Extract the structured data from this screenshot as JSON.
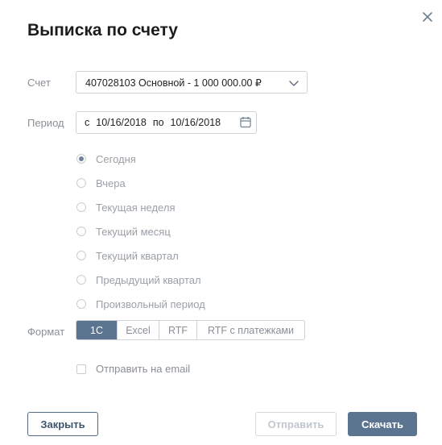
{
  "dialog": {
    "title": "Выписка по счету",
    "close_icon": "close-icon"
  },
  "account": {
    "label": "Счет",
    "selected": "407028103 Основной - 1 000 000.00 ₽",
    "icon": "chevron-down-icon"
  },
  "period": {
    "label": "Период",
    "from_prefix": "с",
    "from": "10/16/2018",
    "to_prefix": "по",
    "to": "10/16/2018",
    "icon": "calendar-icon",
    "options": [
      {
        "label": "Сегодня",
        "selected": true
      },
      {
        "label": "Вчера",
        "selected": false
      },
      {
        "label": "Текущая неделя",
        "selected": false
      },
      {
        "label": "Текущий месяц",
        "selected": false
      },
      {
        "label": "Текущий квартал",
        "selected": false
      },
      {
        "label": "Предыдущий квартал",
        "selected": false
      },
      {
        "label": "Произвольный период",
        "selected": false
      }
    ]
  },
  "format": {
    "label": "Формат",
    "options": [
      {
        "label": "1С",
        "active": true
      },
      {
        "label": "Excel",
        "active": false
      },
      {
        "label": "RTF",
        "active": false
      },
      {
        "label": "RTF с платежками",
        "active": false
      }
    ]
  },
  "email": {
    "label": "Отправить на email",
    "checked": false
  },
  "buttons": {
    "close": "Закрыть",
    "send": "Отправить",
    "download": "Скачать"
  },
  "colors": {
    "accent": "#5b7590",
    "muted_text": "#8a8f96",
    "disabled": "#c2c7cd"
  }
}
